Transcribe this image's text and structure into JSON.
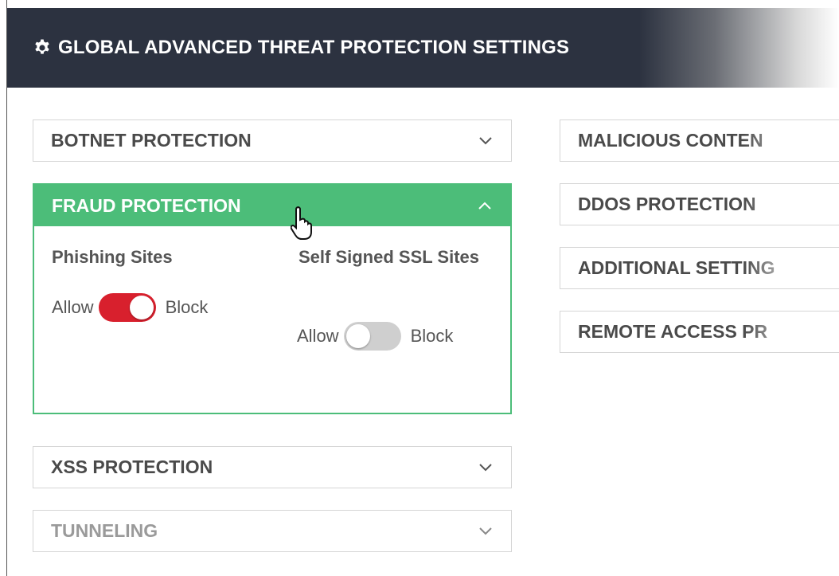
{
  "header": {
    "title": "GLOBAL ADVANCED THREAT PROTECTION SETTINGS",
    "icon": "gear-icon"
  },
  "left_panels": [
    {
      "label": "BOTNET PROTECTION",
      "state": "collapsed",
      "icon": "chevron-down-icon"
    },
    {
      "label": "FRAUD PROTECTION",
      "state": "expanded",
      "icon": "chevron-up-icon"
    },
    {
      "label": "XSS PROTECTION",
      "state": "collapsed",
      "icon": "chevron-down-icon"
    },
    {
      "label": "TUNNELING",
      "state": "collapsed",
      "icon": "chevron-down-icon"
    }
  ],
  "fraud": {
    "phishing": {
      "title": "Phishing Sites",
      "allow": "Allow",
      "block": "Block",
      "state": "block"
    },
    "self_signed": {
      "title": "Self Signed SSL Sites",
      "allow": "Allow",
      "block": "Block",
      "state": "allow"
    }
  },
  "right_panels": [
    {
      "label": "MALICIOUS CONTEN"
    },
    {
      "label": "DDOS PROTECTION"
    },
    {
      "label": "ADDITIONAL SETTING"
    },
    {
      "label": "REMOTE ACCESS PR"
    }
  ],
  "colors": {
    "header_bg": "#2c3240",
    "accent_green": "#4cbd79",
    "toggle_on": "#d8202d",
    "toggle_off": "#cfcfcf"
  }
}
